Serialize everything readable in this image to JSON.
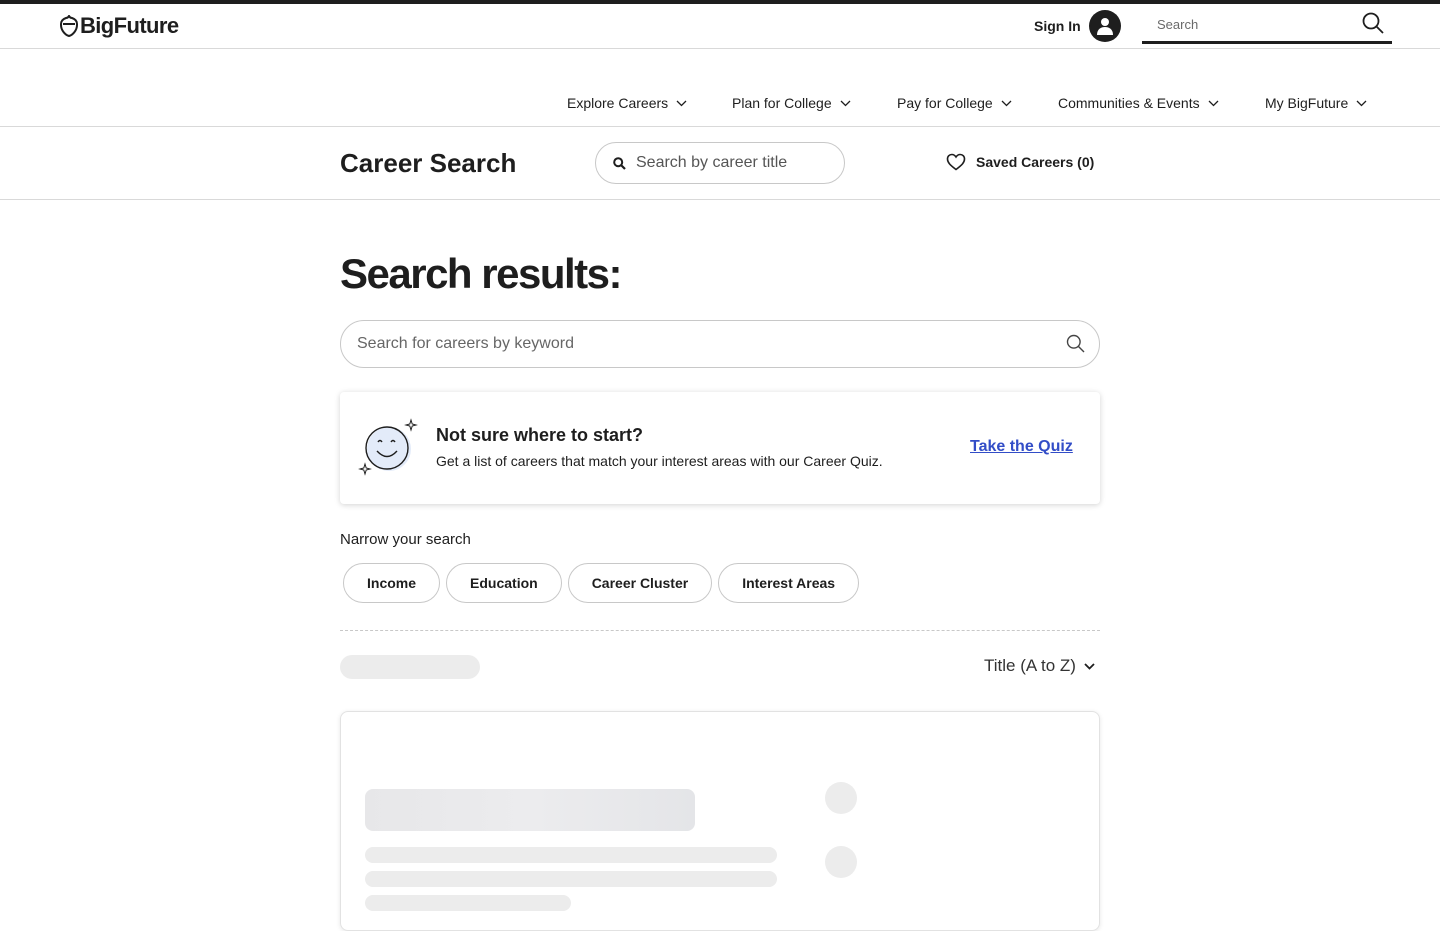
{
  "header": {
    "logo_text": "BigFuture",
    "signin_label": "Sign In",
    "search_placeholder": "Search"
  },
  "nav": {
    "items": [
      {
        "label": "Explore Careers"
      },
      {
        "label": "Plan for College"
      },
      {
        "label": "Pay for College"
      },
      {
        "label": "Communities & Events"
      },
      {
        "label": "My BigFuture"
      }
    ]
  },
  "career_bar": {
    "title": "Career Search",
    "search_placeholder": "Search by career title",
    "saved_label": "Saved Careers (0)"
  },
  "results": {
    "heading": "Search results:",
    "keyword_placeholder": "Search for careers by keyword"
  },
  "quiz": {
    "title": "Not sure where to start?",
    "description": "Get a list of careers that match your interest areas with our Career Quiz.",
    "link_label": "Take the Quiz"
  },
  "narrow": {
    "label": "Narrow your search",
    "filters": [
      "Income",
      "Education",
      "Career Cluster",
      "Interest Areas"
    ]
  },
  "sort": {
    "selected": "Title (A to Z)"
  },
  "colors": {
    "text": "#1e1e1e",
    "link": "#324dc7",
    "border": "#c8c8c8",
    "skeleton": "#ececec"
  },
  "icons": {
    "logo": "acorn-logo-icon",
    "avatar": "user-avatar-icon",
    "search": "search-icon",
    "chevron": "chevron-down-icon",
    "heart": "heart-icon",
    "quiz": "smiley-sparkle-icon"
  }
}
